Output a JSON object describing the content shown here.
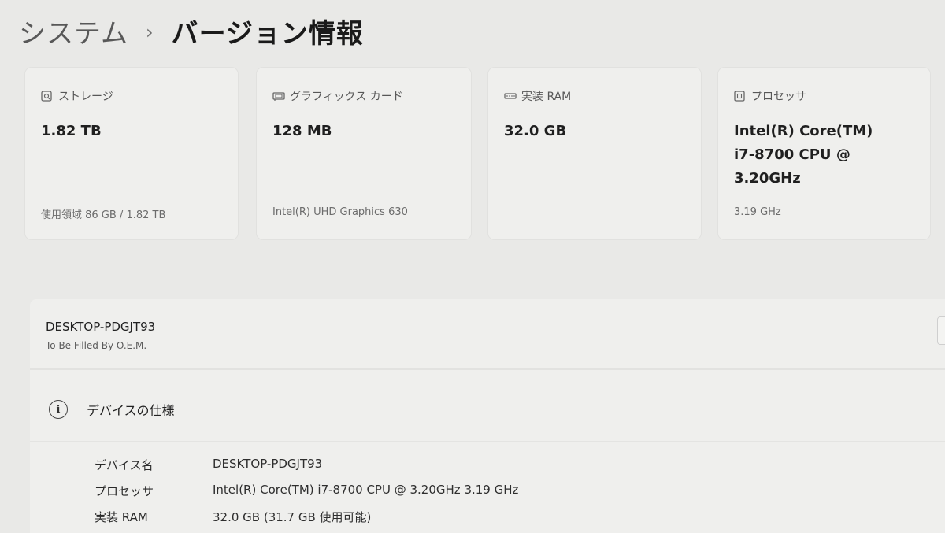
{
  "breadcrumb": {
    "parent": "システム",
    "separator": "›",
    "current": "バージョン情報"
  },
  "cards": [
    {
      "icon": "storage-icon",
      "label": "ストレージ",
      "value": "1.82 TB",
      "sub": "使用領域 86 GB / 1.82 TB"
    },
    {
      "icon": "graphics-card-icon",
      "label": "グラフィックス カード",
      "value": "128 MB",
      "sub": "Intel(R) UHD Graphics 630"
    },
    {
      "icon": "ram-icon",
      "label": "実装 RAM",
      "value": "32.0 GB",
      "sub": ""
    },
    {
      "icon": "processor-icon",
      "label": "プロセッサ",
      "value": "Intel(R) Core(TM)\ni7-8700 CPU @\n3.20GHz",
      "sub": "3.19 GHz"
    }
  ],
  "device": {
    "name": "DESKTOP-PDGJT93",
    "model": "To Be Filled By O.E.M."
  },
  "specs": {
    "title": "デバイスの仕様",
    "rows": [
      {
        "label": "デバイス名",
        "value": "DESKTOP-PDGJT93"
      },
      {
        "label": "プロセッサ",
        "value": "Intel(R) Core(TM) i7-8700 CPU @ 3.20GHz   3.19 GHz"
      },
      {
        "label": "実装 RAM",
        "value": "32.0 GB (31.7 GB 使用可能)"
      }
    ]
  }
}
